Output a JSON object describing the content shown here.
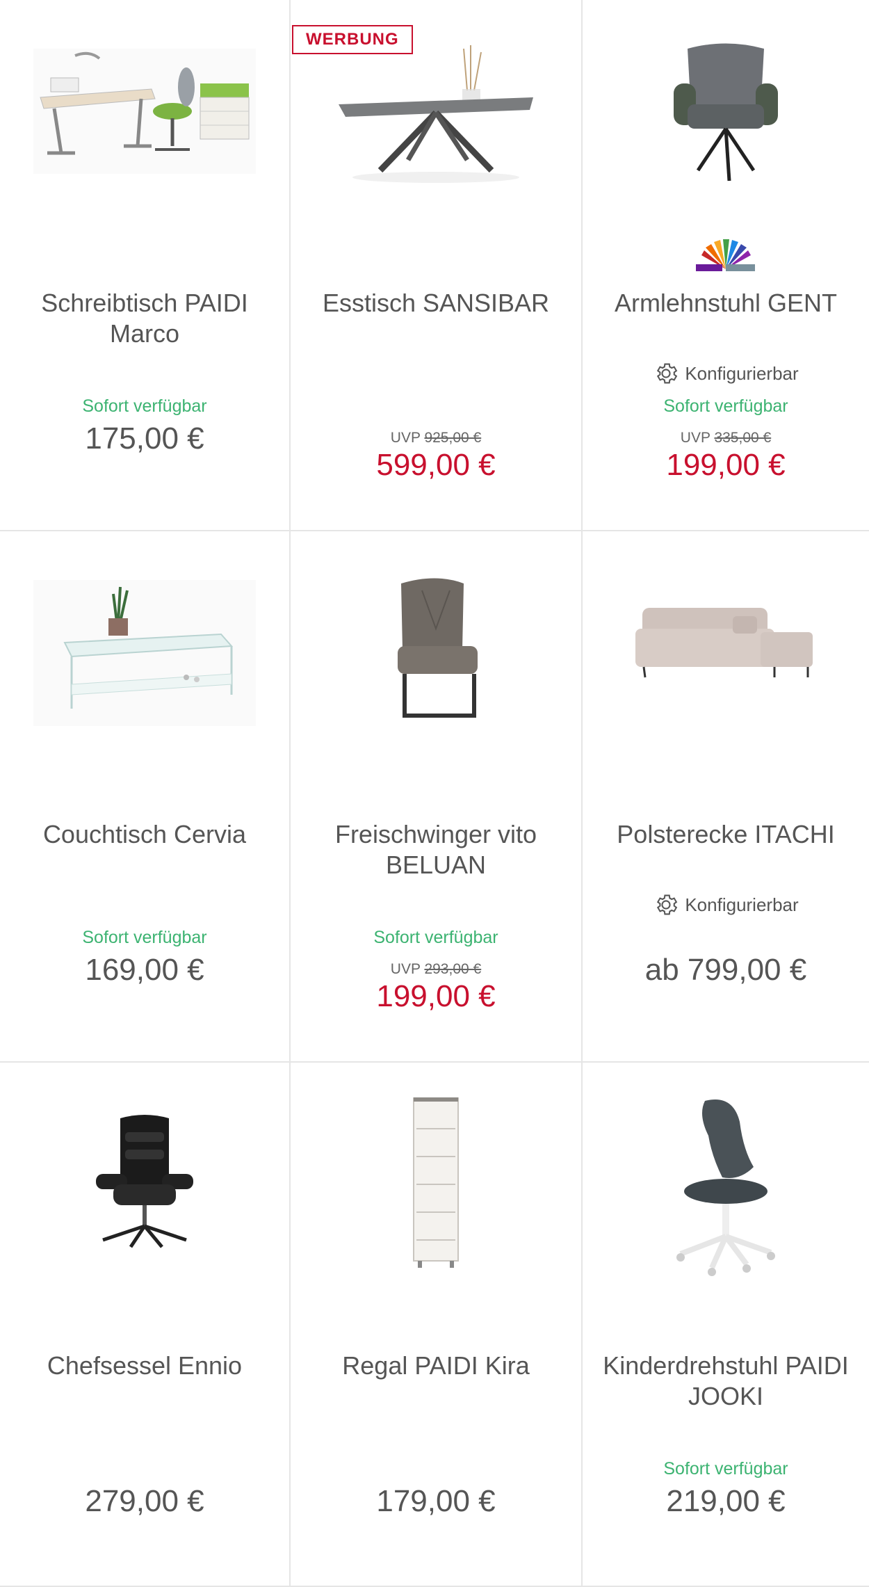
{
  "ad_label": "WERBUNG",
  "colors": {
    "sale": "#c8102e",
    "available": "#3cb371",
    "text": "#555555"
  },
  "products": [
    {
      "title": "Schreibtisch PAIDI Marco",
      "availability": "Sofort verfügbar",
      "price": "175,00 €",
      "icon": "desk-set-image"
    },
    {
      "title": "Esstisch SANSIBAR",
      "uvp_label": "UVP",
      "uvp": "925,00 €",
      "price": "599,00 €",
      "icon": "dining-table-image"
    },
    {
      "title": "Armlehnstuhl GENT",
      "config": "Konfigurierbar",
      "availability": "Sofort verfügbar",
      "uvp_label": "UVP",
      "uvp": "335,00 €",
      "price": "199,00 €",
      "icon": "armchair-image"
    },
    {
      "title": "Couchtisch Cervia",
      "availability": "Sofort verfügbar",
      "price": "169,00 €",
      "icon": "glass-table-image"
    },
    {
      "title": "Freischwinger vito BELUAN",
      "availability": "Sofort verfügbar",
      "uvp_label": "UVP",
      "uvp": "293,00 €",
      "price": "199,00 €",
      "icon": "cantilever-chair-image"
    },
    {
      "title": "Polsterecke ITACHI",
      "config": "Konfigurierbar",
      "price": "ab 799,00 €",
      "icon": "corner-sofa-image"
    },
    {
      "title": "Chefsessel Ennio",
      "price": "279,00 €",
      "icon": "office-chair-image"
    },
    {
      "title": "Regal PAIDI Kira",
      "price": "179,00 €",
      "icon": "shelf-image"
    },
    {
      "title": "Kinderdrehstuhl PAIDI JOOKI",
      "availability": "Sofort verfügbar",
      "price": "219,00 €",
      "icon": "kids-chair-image"
    }
  ]
}
